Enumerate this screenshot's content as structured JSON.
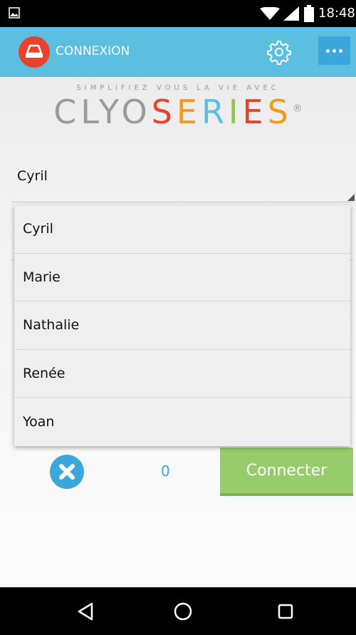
{
  "status_bar": {
    "time": "18:48",
    "icons": [
      "gallery-icon",
      "wifi-icon",
      "signal-icon",
      "battery-icon"
    ]
  },
  "app_bar": {
    "title": "CONNEXION",
    "icons": [
      "app-logo-icon",
      "gear-icon",
      "more-dots-icon"
    ]
  },
  "branding": {
    "tagline": "SIMPLIFIEZ VOUS LA VIE AVEC",
    "logo_part1": "CLYO",
    "logo_part2": "SERIES",
    "registered": "®"
  },
  "user_spinner": {
    "selected": "Cyril"
  },
  "dropdown": {
    "items": [
      "Cyril",
      "Marie",
      "Nathalie",
      "Renée",
      "Yoan"
    ]
  },
  "actions": {
    "count": "0",
    "connect_label": "Connecter"
  },
  "colors": {
    "primary": "#5bc0e0",
    "accent_blue": "#3aa8dc",
    "logo_red": "#e8442d",
    "connect_green": "#97cc6a"
  },
  "nav_bar": {
    "icons": [
      "back-icon",
      "home-icon",
      "recents-icon"
    ]
  }
}
